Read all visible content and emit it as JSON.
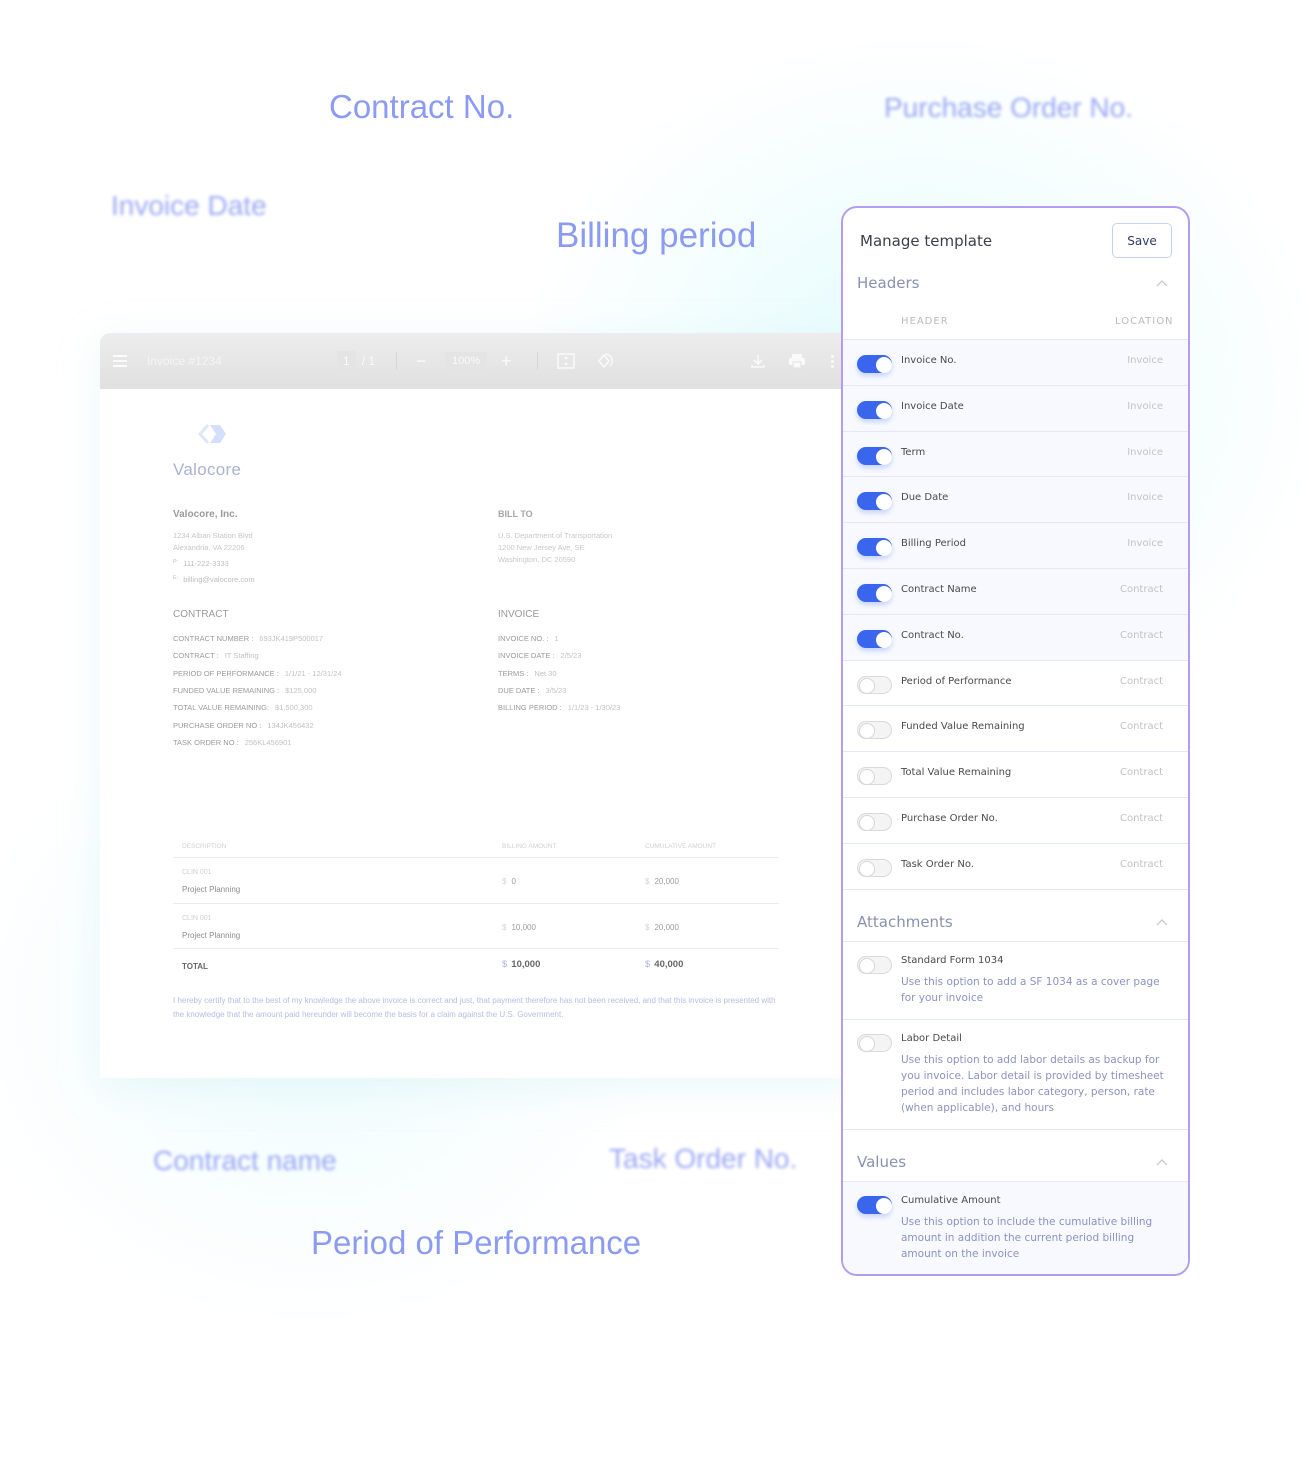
{
  "floating_labels": {
    "contract_no": "Contract No.",
    "purchase_order_no": "Purchase Order No.",
    "invoice_date": "Invoice Date",
    "billing_period": "Billing period",
    "contract_name": "Contract name",
    "task_order_no": "Task Order No.",
    "period_of_performance": "Period of Performance"
  },
  "viewer": {
    "title": "Invoice #1234",
    "current_page": "1",
    "total_pages": "/ 1",
    "zoom": "100%",
    "zoom_out": "−",
    "zoom_in": "+",
    "icons": [
      "menu-icon",
      "fit-page-icon",
      "rotate-icon",
      "download-icon",
      "print-icon",
      "more-vertical-icon"
    ]
  },
  "invoice": {
    "brand_name": "Valocore",
    "company": {
      "name": "Valocore, Inc.",
      "address_line1": "1234 Alban Station Blvd",
      "address_line2": "Alexandria, VA 22206",
      "phone_label": "P:",
      "phone": "111-222-3333",
      "email_label": "E:",
      "email": "billing@valocore.com"
    },
    "bill_to": {
      "heading": "BILL TO",
      "line1": "U.S. Department of Transportation",
      "line2": "1200 New Jersey Ave, SE",
      "line3": "Washington, DC 20590"
    },
    "contract": {
      "heading": "CONTRACT",
      "fields": [
        {
          "label": "CONTRACT NUMBER :",
          "value": "693JK419P500017"
        },
        {
          "label": "CONTRACT :",
          "value": "IT Staffing"
        },
        {
          "label": "PERIOD OF PERFORMANCE :",
          "value": "1/1/21 - 12/31/24"
        },
        {
          "label": "FUNDED VALUE REMAINING :",
          "value": "$125,000"
        },
        {
          "label": "TOTAL VALUE REMAINING:",
          "value": "$1,500,300"
        },
        {
          "label": "PURCHASE ORDER NO :",
          "value": "134JK456432"
        },
        {
          "label": "TASK ORDER NO :",
          "value": "256KL456901"
        }
      ]
    },
    "invoice_info": {
      "heading": "INVOICE",
      "fields": [
        {
          "label": "INVOICE NO. :",
          "value": "1"
        },
        {
          "label": "INVOICE DATE :",
          "value": "2/5/23"
        },
        {
          "label": "TERMS :",
          "value": "Net 30"
        },
        {
          "label": "DUE DATE :",
          "value": "3/5/23"
        },
        {
          "label": "BILLING PERIOD :",
          "value": "1/1/23 - 1/30/23"
        }
      ]
    },
    "table": {
      "headers": [
        "DESCRIPTION",
        "BILLING AMOUNT",
        "CUMULATIVE AMOUNT"
      ],
      "currency": "$",
      "rows": [
        {
          "clin": "CLIN 001",
          "description": "Project Planning",
          "billing": "0",
          "cumulative": "20,000"
        },
        {
          "clin": "CLIN 001",
          "description": "Project Planning",
          "billing": "10,000",
          "cumulative": "20,000"
        }
      ],
      "total_label": "TOTAL",
      "total_billing": "10,000",
      "total_cumulative": "40,000"
    },
    "certification": "I hereby certify that to the best of my knowledge the above invoice is correct and just, that payment therefore has not been received, and that this invoice is presented with the knowledge that the amount paid hereunder will become the basis for a claim against the U.S. Government."
  },
  "panel": {
    "title": "Manage template",
    "save_label": "Save",
    "headers_section": {
      "title": "Headers",
      "col_header": "HEADER",
      "col_location": "LOCATION",
      "items": [
        {
          "label": "Invoice No.",
          "location": "Invoice",
          "enabled": true
        },
        {
          "label": "Invoice Date",
          "location": "Invoice",
          "enabled": true
        },
        {
          "label": "Term",
          "location": "Invoice",
          "enabled": true
        },
        {
          "label": "Due Date",
          "location": "Invoice",
          "enabled": true
        },
        {
          "label": "Billing Period",
          "location": "Invoice",
          "enabled": true
        },
        {
          "label": "Contract Name",
          "location": "Contract",
          "enabled": true
        },
        {
          "label": "Contract No.",
          "location": "Contract",
          "enabled": true
        },
        {
          "label": "Period of Performance",
          "location": "Contract",
          "enabled": false
        },
        {
          "label": "Funded Value Remaining",
          "location": "Contract",
          "enabled": false
        },
        {
          "label": "Total Value Remaining",
          "location": "Contract",
          "enabled": false
        },
        {
          "label": "Purchase Order No.",
          "location": "Contract",
          "enabled": false
        },
        {
          "label": "Task Order No.",
          "location": "Contract",
          "enabled": false
        }
      ]
    },
    "attachments_section": {
      "title": "Attachments",
      "items": [
        {
          "label": "Standard Form 1034",
          "description": "Use this option to add a SF 1034 as a cover page for your invoice",
          "enabled": false
        },
        {
          "label": "Labor Detail",
          "description": "Use this option to add labor details as backup for you invoice. Labor detail is provided by timesheet period and includes labor category, person, rate (when applicable), and hours",
          "enabled": false
        }
      ]
    },
    "values_section": {
      "title": "Values",
      "items": [
        {
          "label": "Cumulative Amount",
          "description": "Use this option to include the cumulative billing amount in addition the current period billing amount on the invoice",
          "enabled": true
        }
      ]
    },
    "colors": {
      "accent": "#3a66ee",
      "panel_border": "#b69cee",
      "floating_label": "#8c9bf2"
    }
  }
}
